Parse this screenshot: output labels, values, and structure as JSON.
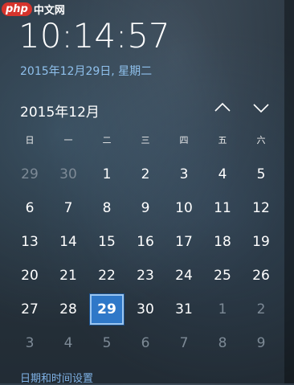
{
  "watermark": {
    "logo": "php",
    "site": "中文网"
  },
  "clock": {
    "time": "10:14:57",
    "date": "2015年12月29日, 星期二"
  },
  "calendar": {
    "month_title": "2015年12月",
    "prev_icon": "chevron-up-icon",
    "next_icon": "chevron-down-icon",
    "weekdays": [
      "日",
      "一",
      "二",
      "三",
      "四",
      "五",
      "六"
    ],
    "weeks": [
      [
        {
          "d": "29",
          "o": true
        },
        {
          "d": "30",
          "o": true
        },
        {
          "d": "1"
        },
        {
          "d": "2"
        },
        {
          "d": "3"
        },
        {
          "d": "4"
        },
        {
          "d": "5"
        }
      ],
      [
        {
          "d": "6"
        },
        {
          "d": "7"
        },
        {
          "d": "8"
        },
        {
          "d": "9"
        },
        {
          "d": "10"
        },
        {
          "d": "11"
        },
        {
          "d": "12"
        }
      ],
      [
        {
          "d": "13"
        },
        {
          "d": "14"
        },
        {
          "d": "15"
        },
        {
          "d": "16"
        },
        {
          "d": "17"
        },
        {
          "d": "18"
        },
        {
          "d": "19"
        }
      ],
      [
        {
          "d": "20"
        },
        {
          "d": "21"
        },
        {
          "d": "22"
        },
        {
          "d": "23"
        },
        {
          "d": "24"
        },
        {
          "d": "25"
        },
        {
          "d": "26"
        }
      ],
      [
        {
          "d": "27"
        },
        {
          "d": "28"
        },
        {
          "d": "29",
          "today": true
        },
        {
          "d": "30"
        },
        {
          "d": "31"
        },
        {
          "d": "1",
          "o": true
        },
        {
          "d": "2",
          "o": true
        }
      ],
      [
        {
          "d": "3",
          "o": true
        },
        {
          "d": "4",
          "o": true
        },
        {
          "d": "5",
          "o": true
        },
        {
          "d": "6",
          "o": true
        },
        {
          "d": "7",
          "o": true
        },
        {
          "d": "8",
          "o": true
        },
        {
          "d": "9",
          "o": true
        }
      ]
    ]
  },
  "footer": {
    "settings_link": "日期和时间设置"
  },
  "colors": {
    "accent": "#2f78c8",
    "link": "#7fb2e6",
    "date_text": "#8fc0ec"
  }
}
